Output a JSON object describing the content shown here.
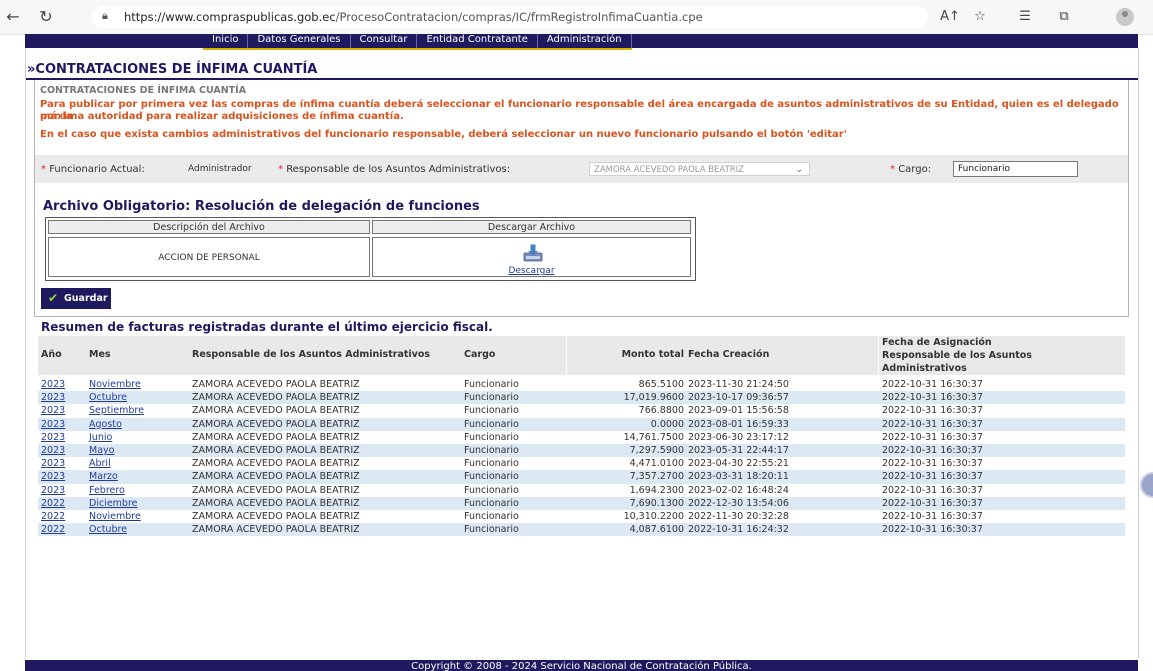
{
  "browser": {
    "url_scheme_host": "https://www.compraspublicas.gob.ec",
    "url_path": "/ProcesoContratacion/compras/IC/frmRegistroInfimaCuantia.cpe",
    "back_icon": "back-arrow-icon",
    "reload_icon": "reload-icon"
  },
  "nav": {
    "items": [
      "Inicio",
      "Datos Generales",
      "Consultar",
      "Entidad Contratante",
      "Administración"
    ]
  },
  "page": {
    "title": "»CONTRATACIONES DE ÍNFIMA CUANTÍA",
    "subtitle": "CONTRATACIONES DE ÍNFIMA CUANTÍA",
    "warning_line1": "Para publicar por primera vez las compras de ínfima cuantía deberá seleccionar el funcionario responsable del área encargada de asuntos administrativos de su Entidad, quien es el delegado por la",
    "warning_line2": "máxima autoridad para realizar adquisiciones de ínfima cuantía.",
    "warning_line3": "En el caso que exista cambios administrativos del funcionario responsable, deberá seleccionar un nuevo funcionario pulsando el botón 'editar'"
  },
  "form": {
    "funcionario_label": "Funcionario Actual:",
    "funcionario_value": "Administrador",
    "responsable_label": "Responsable de los Asuntos Administrativos:",
    "responsable_selected": "ZAMORA ACEVEDO PAOLA BEATRIZ",
    "cargo_label": "Cargo:",
    "cargo_value": "Funcionario",
    "required_mark": "*"
  },
  "file_section": {
    "title": "Archivo Obligatorio: Resolución de delegación de funciones",
    "col_desc": "Descripción del Archivo",
    "col_download": "Descargar Archivo",
    "file_desc": "ACCION DE PERSONAL",
    "download_link": "Descargar"
  },
  "save_button": "Guardar",
  "summary": {
    "title": "Resumen de facturas registradas durante el último ejercicio fiscal.",
    "headers": {
      "anio": "Año",
      "mes": "Mes",
      "responsable": "Responsable de los Asuntos Administrativos",
      "cargo": "Cargo",
      "monto": "Monto total",
      "fecha_creacion": "Fecha Creación",
      "fecha_asig_1": "Fecha de Asignación",
      "fecha_asig_2": "Responsable de los Asuntos",
      "fecha_asig_3": "Administrativos"
    },
    "rows": [
      {
        "anio": "2023",
        "mes": "Noviembre",
        "resp": "ZAMORA ACEVEDO PAOLA BEATRIZ",
        "cargo": "Funcionario",
        "monto": "865.5100",
        "fc": "2023-11-30 21:24:50",
        "fa": "2022-10-31 16:30:37"
      },
      {
        "anio": "2023",
        "mes": "Octubre",
        "resp": "ZAMORA ACEVEDO PAOLA BEATRIZ",
        "cargo": "Funcionario",
        "monto": "17,019.9600",
        "fc": "2023-10-17 09:36:57",
        "fa": "2022-10-31 16:30:37"
      },
      {
        "anio": "2023",
        "mes": "Septiembre",
        "resp": "ZAMORA ACEVEDO PAOLA BEATRIZ",
        "cargo": "Funcionario",
        "monto": "766.8800",
        "fc": "2023-09-01 15:56:58",
        "fa": "2022-10-31 16:30:37"
      },
      {
        "anio": "2023",
        "mes": "Agosto",
        "resp": "ZAMORA ACEVEDO PAOLA BEATRIZ",
        "cargo": "Funcionario",
        "monto": "0.0000",
        "fc": "2023-08-01 16:59:33",
        "fa": "2022-10-31 16:30:37"
      },
      {
        "anio": "2023",
        "mes": "Junio",
        "resp": "ZAMORA ACEVEDO PAOLA BEATRIZ",
        "cargo": "Funcionario",
        "monto": "14,761.7500",
        "fc": "2023-06-30 23:17:12",
        "fa": "2022-10-31 16:30:37"
      },
      {
        "anio": "2023",
        "mes": "Mayo",
        "resp": "ZAMORA ACEVEDO PAOLA BEATRIZ",
        "cargo": "Funcionario",
        "monto": "7,297.5900",
        "fc": "2023-05-31 22:44:17",
        "fa": "2022-10-31 16:30:37"
      },
      {
        "anio": "2023",
        "mes": "Abril",
        "resp": "ZAMORA ACEVEDO PAOLA BEATRIZ",
        "cargo": "Funcionario",
        "monto": "4,471.0100",
        "fc": "2023-04-30 22:55:21",
        "fa": "2022-10-31 16:30:37"
      },
      {
        "anio": "2023",
        "mes": "Marzo",
        "resp": "ZAMORA ACEVEDO PAOLA BEATRIZ",
        "cargo": "Funcionario",
        "monto": "7,357.2700",
        "fc": "2023-03-31 18:20:11",
        "fa": "2022-10-31 16:30:37"
      },
      {
        "anio": "2023",
        "mes": "Febrero",
        "resp": "ZAMORA ACEVEDO PAOLA BEATRIZ",
        "cargo": "Funcionario",
        "monto": "1,694.2300",
        "fc": "2023-02-02 16:48:24",
        "fa": "2022-10-31 16:30:37"
      },
      {
        "anio": "2022",
        "mes": "Diciembre",
        "resp": "ZAMORA ACEVEDO PAOLA BEATRIZ",
        "cargo": "Funcionario",
        "monto": "7,690.1300",
        "fc": "2022-12-30 13:54:06",
        "fa": "2022-10-31 16:30:37"
      },
      {
        "anio": "2022",
        "mes": "Noviembre",
        "resp": "ZAMORA ACEVEDO PAOLA BEATRIZ",
        "cargo": "Funcionario",
        "monto": "10,310.2200",
        "fc": "2022-11-30 20:32:28",
        "fa": "2022-10-31 16:30:37"
      },
      {
        "anio": "2022",
        "mes": "Octubre",
        "resp": "ZAMORA ACEVEDO PAOLA BEATRIZ",
        "cargo": "Funcionario",
        "monto": "4,087.6100",
        "fc": "2022-10-31 16:24:32",
        "fa": "2022-10-31 16:30:37"
      }
    ]
  },
  "footer": "Copyright © 2008 - 2024 Servicio Nacional de Contratación Pública.",
  "colors": {
    "brand": "#1f1a5f",
    "warning": "#d9531e",
    "row_alt": "#dde8f5",
    "accent_gold": "#d8b300"
  }
}
